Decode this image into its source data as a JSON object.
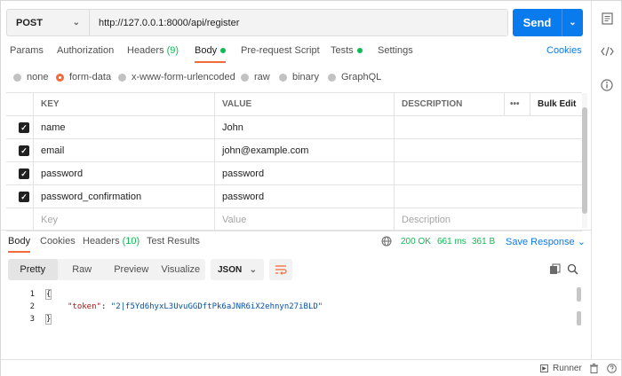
{
  "request": {
    "method": "POST",
    "url": "http://127.0.0.1:8000/api/register",
    "send_label": "Send"
  },
  "request_tabs": [
    {
      "label": "Params"
    },
    {
      "label": "Authorization"
    },
    {
      "label": "Headers",
      "count": "(9)"
    },
    {
      "label": "Body",
      "active": true,
      "dot": true
    },
    {
      "label": "Pre-request Script"
    },
    {
      "label": "Tests",
      "dot": true
    },
    {
      "label": "Settings"
    }
  ],
  "cookies_label": "Cookies",
  "body_types": [
    {
      "label": "none"
    },
    {
      "label": "form-data",
      "selected": true
    },
    {
      "label": "x-www-form-urlencoded"
    },
    {
      "label": "raw"
    },
    {
      "label": "binary"
    },
    {
      "label": "GraphQL"
    }
  ],
  "table": {
    "headers": {
      "key": "KEY",
      "value": "VALUE",
      "description": "DESCRIPTION",
      "more": "•••",
      "bulk_edit": "Bulk Edit"
    },
    "rows": [
      {
        "key": "name",
        "value": "John",
        "checked": true
      },
      {
        "key": "email",
        "value": "john@example.com",
        "checked": true
      },
      {
        "key": "password",
        "value": "password",
        "checked": true
      },
      {
        "key": "password_confirmation",
        "value": "password",
        "checked": true
      }
    ],
    "placeholders": {
      "key": "Key",
      "value": "Value",
      "description": "Description"
    }
  },
  "response_tabs": [
    {
      "label": "Body",
      "active": true
    },
    {
      "label": "Cookies"
    },
    {
      "label": "Headers",
      "count": "(10)"
    },
    {
      "label": "Test Results"
    }
  ],
  "response_status": {
    "status": "200 OK",
    "time": "661 ms",
    "size": "361 B"
  },
  "save_response_label": "Save Response",
  "view_modes": [
    "Pretty",
    "Raw",
    "Preview",
    "Visualize"
  ],
  "format": "JSON",
  "code": {
    "line_numbers": [
      "1",
      "2",
      "3"
    ],
    "open_brace": "{",
    "key": "\"token\"",
    "colon": ": ",
    "value": "\"2|f5Yd6hyxL3UvuGGDftPk6aJNR6iX2ehnyn27iBLD\"",
    "close_brace": "}"
  },
  "footer": {
    "runner_label": "Runner"
  },
  "colors": {
    "accent": "#f26b3a",
    "primary": "#097bed",
    "success": "#0cbb52"
  }
}
